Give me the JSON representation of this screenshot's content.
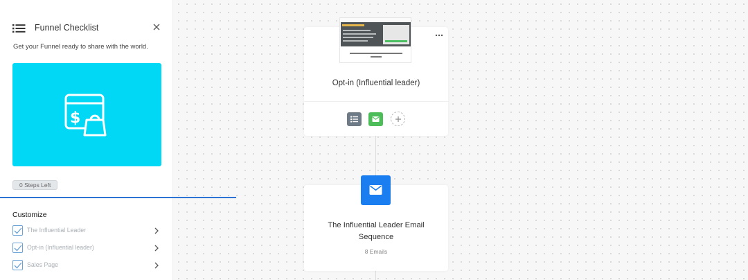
{
  "checklist": {
    "title": "Funnel Checklist",
    "subtitle": "Get your Funnel ready to share with the world.",
    "steps_left": "0 Steps Left",
    "customize_heading": "Customize",
    "items": [
      {
        "label": "The Influential Leader",
        "checked": true
      },
      {
        "label": "Opt-in (Influential leader)",
        "checked": true
      },
      {
        "label": "Sales Page",
        "checked": true
      }
    ],
    "hero_icon": "store-bag-icon",
    "hero_color": "#00d8f5"
  },
  "canvas": {
    "optin_card": {
      "title": "Opt-in (Influential leader)",
      "actions": [
        "list-icon",
        "mail-icon",
        "plus-icon"
      ]
    },
    "email_card": {
      "title": "The Influential Leader Email Sequence",
      "count": "8 Emails",
      "icon": "mail-icon",
      "icon_color": "#1a7ef0"
    }
  },
  "colors": {
    "accent": "#2b74d6",
    "mail_green": "#4dbd5a",
    "list_gray": "#6e7b87"
  }
}
